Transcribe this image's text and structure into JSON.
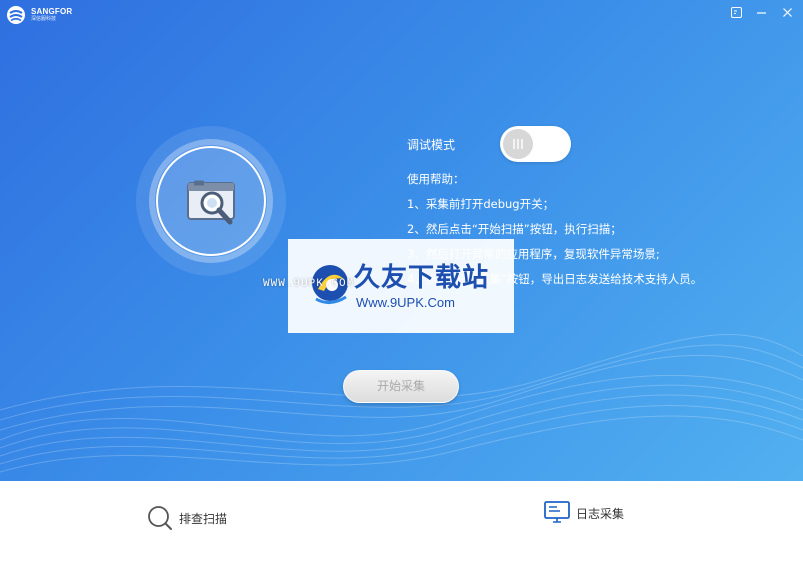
{
  "brand": {
    "name_en": "SANGFOR",
    "name_cn": "深信服科技"
  },
  "window": {
    "icons": [
      "feedback-icon",
      "minimize-icon",
      "close-icon"
    ]
  },
  "debug": {
    "label": "调试模式",
    "enabled": false
  },
  "help": {
    "title": "使用帮助：",
    "lines": [
      "1、采集前打开debug开关；",
      "2、然后点击“开始扫描”按钮，执行扫描；",
      "3、然后打开异常的应用程序，复现软件异常场景;",
      "4、点击“开始采集”按钮，导出日志发送给技术支持人员。"
    ]
  },
  "start_button": {
    "label": "开始采集"
  },
  "tabs": [
    {
      "label": "排查扫描",
      "icon": "search-icon"
    },
    {
      "label": "日志采集",
      "icon": "monitor-icon"
    }
  ],
  "watermark": {
    "title": "久友下载站",
    "url": "Www.9UPK.Com",
    "left_url": "WWW.9UPK.COM"
  },
  "colors": {
    "accent": "#2f6fe0",
    "toggle_knob": "#d7d7d7",
    "button_text": "#a9a9a9"
  }
}
